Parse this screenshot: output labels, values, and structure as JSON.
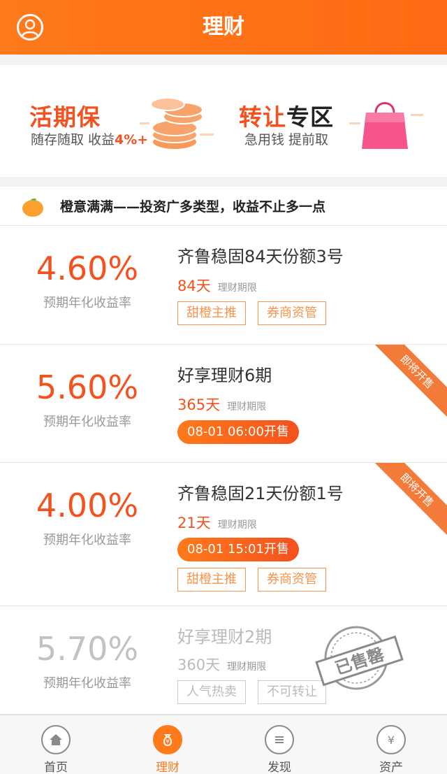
{
  "header": {
    "title": "理财"
  },
  "promos": {
    "left": {
      "title": "活期保",
      "sub_prefix": "随存随取 收益",
      "sub_yield": "4%+"
    },
    "right": {
      "title_a": "转让",
      "title_b": "专区",
      "sub": "急用钱 提前取"
    }
  },
  "slogan": "橙意满满——投资广多类型，收益不止多一点",
  "products": [
    {
      "rate": "4.60%",
      "rate_label": "预期年化收益率",
      "name": "齐鲁稳固84天份额3号",
      "period": "84天",
      "period_label": "理财期限",
      "tags": [
        "甜橙主推",
        "券商资管"
      ]
    },
    {
      "rate": "5.60%",
      "rate_label": "预期年化收益率",
      "name": "好享理财6期",
      "period": "365天",
      "period_label": "理财期限",
      "sale": "08-01 06:00开售",
      "ribbon": "即将开售"
    },
    {
      "rate": "4.00%",
      "rate_label": "预期年化收益率",
      "name": "齐鲁稳固21天份额1号",
      "period": "21天",
      "period_label": "理财期限",
      "sale": "08-01 15:01开售",
      "ribbon": "即将开售",
      "tags": [
        "甜橙主推",
        "券商资管"
      ]
    },
    {
      "rate": "5.70%",
      "rate_label": "预期年化收益率",
      "name": "好享理财2期",
      "period": "360天",
      "period_label": "理财期限",
      "tags": [
        "人气热卖",
        "不可转让"
      ],
      "stamp": "已售罄"
    }
  ],
  "tabs": [
    {
      "label": "首页",
      "icon": "home-icon"
    },
    {
      "label": "理财",
      "icon": "money-bag-icon",
      "active": true
    },
    {
      "label": "发现",
      "icon": "discover-icon"
    },
    {
      "label": "资产",
      "icon": "yuan-icon"
    }
  ],
  "colors": {
    "accent": "#ff7a1a",
    "rate": "#f4511e",
    "tag": "#f7934a",
    "sold_out": "#c2c2c2"
  }
}
